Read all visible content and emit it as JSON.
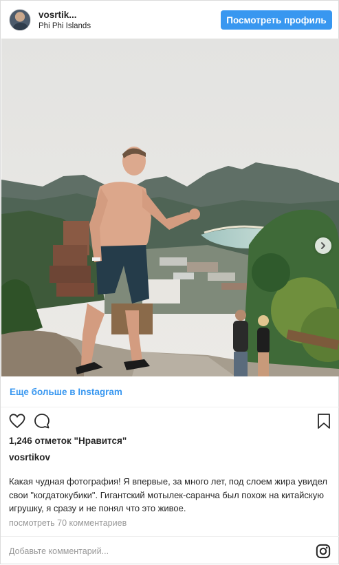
{
  "header": {
    "username": "vosrtik...",
    "location": "Phi Phi Islands",
    "view_profile_label": "Посмотреть профиль"
  },
  "photo": {
    "icon": "photo-of-man-at-viewpoint",
    "next_icon": "chevron-right-icon"
  },
  "more_link": "Еще больше в Instagram",
  "actions": {
    "like_icon": "heart-icon",
    "comment_icon": "comment-icon",
    "save_icon": "bookmark-icon"
  },
  "likes_text": "1,246 отметок \"Нравится\"",
  "owner": "vosrtikov",
  "caption": "Какая чудная фотография! Я впервые, за много лет, под слоем жира увидел свои \"когдатокубики\". Гигантский мотылек-саранча был похож на китайскую игрушку, я сразу и не понял что это живое.",
  "comments_link": "посмотреть 70 комментариев",
  "comment_placeholder": "Добавьте комментарий...",
  "brand_icon": "instagram-logo-icon",
  "colors": {
    "accent": "#3897f0",
    "text": "#262626",
    "muted": "#999999"
  }
}
